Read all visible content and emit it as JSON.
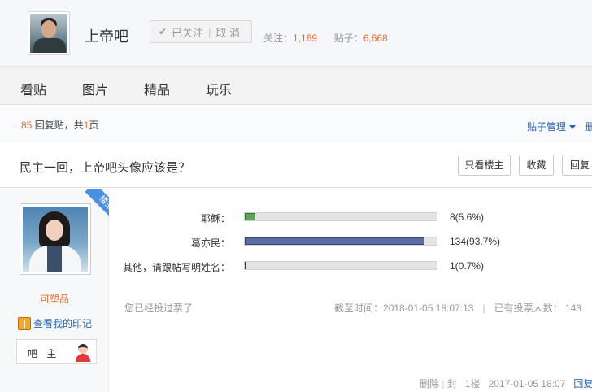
{
  "header": {
    "forum_name": "上帝吧",
    "followed_label": "已关注",
    "cancel_label": "取 消",
    "follow_label": "关注：",
    "follow_count": "1,169",
    "posts_label": "贴子：",
    "posts_count": "6,668"
  },
  "nav": {
    "items": [
      "看贴",
      "图片",
      "精品",
      "玩乐"
    ]
  },
  "threadbar": {
    "reply_num": "85",
    "reply_text": "回复贴，共",
    "page_num": "1",
    "page_text": "页",
    "manage_label": "贴子管理",
    "cut_label": "删"
  },
  "thread": {
    "title": "民主一回，上帝吧头像应该是？",
    "buttons": [
      "只看楼主",
      "收藏",
      "回复"
    ]
  },
  "author": {
    "corner_label": "楼主",
    "name": "可塑品",
    "mark_link": "查看我的印记",
    "role": "吧 主"
  },
  "poll": {
    "options": [
      {
        "label": "耶稣：",
        "value": "8(5.6%)",
        "pct": 5.6,
        "color": "#5aa654"
      },
      {
        "label": "葛亦民：",
        "value": "134(93.7%)",
        "pct": 93.7,
        "color": "#5b6ba6"
      },
      {
        "label": "其他，请跟帖写明姓名：",
        "value": "1(0.7%)",
        "pct": 0.7,
        "color": "#555555"
      }
    ],
    "voted_text": "您已经投过票了",
    "deadline_label": "截至时间：",
    "deadline": "2018-01-05 18:07:13",
    "voters_label": "已有投票人数：",
    "voters": "143"
  },
  "footer": {
    "delete": "删除",
    "block": "封",
    "floor": "1楼",
    "time": "2017-01-05 18:07",
    "reply": "回复"
  }
}
